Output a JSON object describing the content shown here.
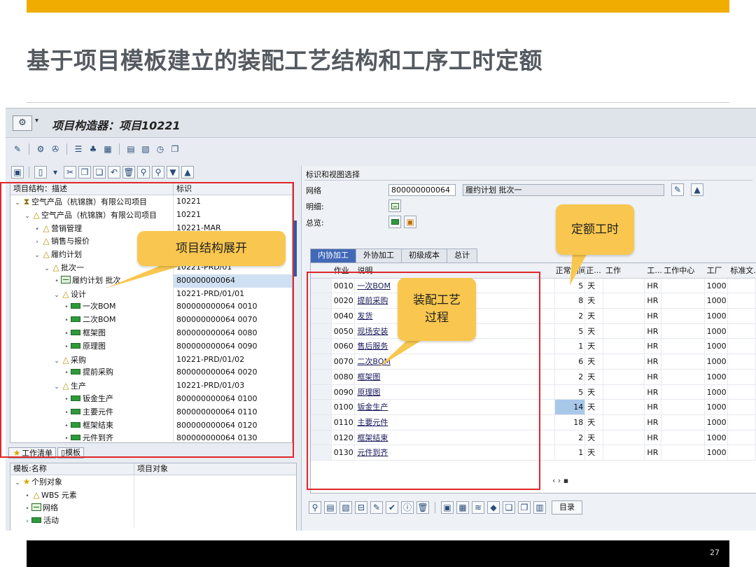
{
  "slide": {
    "title": "基于项目模板建立的装配工艺结构和工序工时定额",
    "page_number": "27"
  },
  "window": {
    "title": "项目构造器：项目10221"
  },
  "structure_tree": {
    "header": [
      "项目结构：描述",
      "标识"
    ],
    "rows": [
      {
        "level": 0,
        "icon": "project",
        "expander": "open",
        "label": "空气产品（杭锦旗）有限公司项目",
        "id": "10221"
      },
      {
        "level": 1,
        "icon": "wbs",
        "expander": "open",
        "label": "空气产品（杭锦旗）有限公司项目",
        "id": "10221"
      },
      {
        "level": 2,
        "icon": "wbs",
        "expander": "leaf",
        "label": "营销管理",
        "id": "10221-MAR"
      },
      {
        "level": 2,
        "icon": "wbs",
        "expander": "closed",
        "label": "销售与报价",
        "id": ""
      },
      {
        "level": 2,
        "icon": "wbs",
        "expander": "open",
        "label": "履约计划",
        "id": ""
      },
      {
        "level": 3,
        "icon": "wbs",
        "expander": "open",
        "label": "批次一",
        "id": "10221-PRD/01"
      },
      {
        "level": 4,
        "icon": "network",
        "expander": "leaf",
        "label": "履约计划 批次",
        "id": "800000000064",
        "selected": true
      },
      {
        "level": 4,
        "icon": "wbs",
        "expander": "open",
        "label": "设计",
        "id": "10221-PRD/01/01"
      },
      {
        "level": 5,
        "icon": "activity",
        "expander": "leaf",
        "label": "一次BOM",
        "id": "800000000064 0010"
      },
      {
        "level": 5,
        "icon": "activity",
        "expander": "leaf",
        "label": "二次BOM",
        "id": "800000000064 0070"
      },
      {
        "level": 5,
        "icon": "activity",
        "expander": "leaf",
        "label": "框架图",
        "id": "800000000064 0080"
      },
      {
        "level": 5,
        "icon": "activity",
        "expander": "leaf",
        "label": "原理图",
        "id": "800000000064 0090"
      },
      {
        "level": 4,
        "icon": "wbs",
        "expander": "open",
        "label": "采购",
        "id": "10221-PRD/01/02"
      },
      {
        "level": 5,
        "icon": "activity",
        "expander": "leaf",
        "label": "提前采购",
        "id": "800000000064 0020"
      },
      {
        "level": 4,
        "icon": "wbs",
        "expander": "open",
        "label": "生产",
        "id": "10221-PRD/01/03"
      },
      {
        "level": 5,
        "icon": "activity",
        "expander": "leaf",
        "label": "钣金生产",
        "id": "800000000064 0100"
      },
      {
        "level": 5,
        "icon": "activity",
        "expander": "leaf",
        "label": "主要元件",
        "id": "800000000064 0110"
      },
      {
        "level": 5,
        "icon": "activity",
        "expander": "leaf",
        "label": "框架结束",
        "id": "800000000064 0120"
      },
      {
        "level": 5,
        "icon": "activity",
        "expander": "leaf",
        "label": "元件到齐",
        "id": "800000000064 0130"
      }
    ]
  },
  "left_tabs": [
    "工作清单",
    "模板"
  ],
  "template_tree": {
    "header": [
      "模板:名称",
      "项目对象"
    ],
    "rows": [
      {
        "level": 0,
        "icon": "star",
        "expander": "open",
        "label": "个别对象"
      },
      {
        "level": 1,
        "icon": "wbs",
        "expander": "leaf",
        "label": "WBS 元素"
      },
      {
        "level": 1,
        "icon": "network",
        "expander": "leaf",
        "label": "网络"
      },
      {
        "level": 1,
        "icon": "activity",
        "expander": "closed",
        "label": "活动"
      }
    ]
  },
  "detail": {
    "section_title": "标识和视图选择",
    "network_label": "网络",
    "network_value": "800000000064",
    "network_desc": "履约计划 批次一",
    "detail_label": "明细:",
    "overview_label": "总览:"
  },
  "tabs": [
    {
      "label": "内协加工",
      "active": true
    },
    {
      "label": "外协加工",
      "active": false
    },
    {
      "label": "初级成本",
      "active": false
    },
    {
      "label": "总计",
      "active": false
    }
  ],
  "operations_table": {
    "columns": [
      "作业",
      "说明",
      "正常期间",
      "正...",
      "工作",
      "工...",
      "工作中心",
      "工厂",
      "标准文..."
    ],
    "rows": [
      {
        "op": "0010",
        "desc": "一次BOM",
        "dur": "5",
        "unit": "天",
        "wc": "HR",
        "plant": "1000"
      },
      {
        "op": "0020",
        "desc": "提前采购",
        "dur": "8",
        "unit": "天",
        "wc": "HR",
        "plant": "1000"
      },
      {
        "op": "0040",
        "desc": "发货",
        "dur": "2",
        "unit": "天",
        "wc": "HR",
        "plant": "1000"
      },
      {
        "op": "0050",
        "desc": "现场安装",
        "dur": "5",
        "unit": "天",
        "wc": "HR",
        "plant": "1000"
      },
      {
        "op": "0060",
        "desc": "售后服务",
        "dur": "1",
        "unit": "天",
        "wc": "HR",
        "plant": "1000"
      },
      {
        "op": "0070",
        "desc": "二次BOM",
        "dur": "6",
        "unit": "天",
        "wc": "HR",
        "plant": "1000"
      },
      {
        "op": "0080",
        "desc": "框架图",
        "dur": "2",
        "unit": "天",
        "wc": "HR",
        "plant": "1000"
      },
      {
        "op": "0090",
        "desc": "原理图",
        "dur": "5",
        "unit": "天",
        "wc": "HR",
        "plant": "1000"
      },
      {
        "op": "0100",
        "desc": "钣金生产",
        "dur": "14",
        "unit": "天",
        "wc": "HR",
        "plant": "1000",
        "highlight": true
      },
      {
        "op": "0110",
        "desc": "主要元件",
        "dur": "18",
        "unit": "天",
        "wc": "HR",
        "plant": "1000"
      },
      {
        "op": "0120",
        "desc": "框架结束",
        "dur": "2",
        "unit": "天",
        "wc": "HR",
        "plant": "1000"
      },
      {
        "op": "0130",
        "desc": "元件到齐",
        "dur": "1",
        "unit": "天",
        "wc": "HR",
        "plant": "1000"
      }
    ]
  },
  "bottom_toolbar": {
    "directory_label": "目录"
  },
  "callouts": {
    "structure": "项目结构展开",
    "process": "装配工艺\n过程",
    "hours": "定额工时"
  },
  "colors": {
    "accent_bar": "#f0ad00",
    "callout": "#f9c74f",
    "highlight_box": "#e0262b",
    "active_tab": "#4169b8"
  }
}
